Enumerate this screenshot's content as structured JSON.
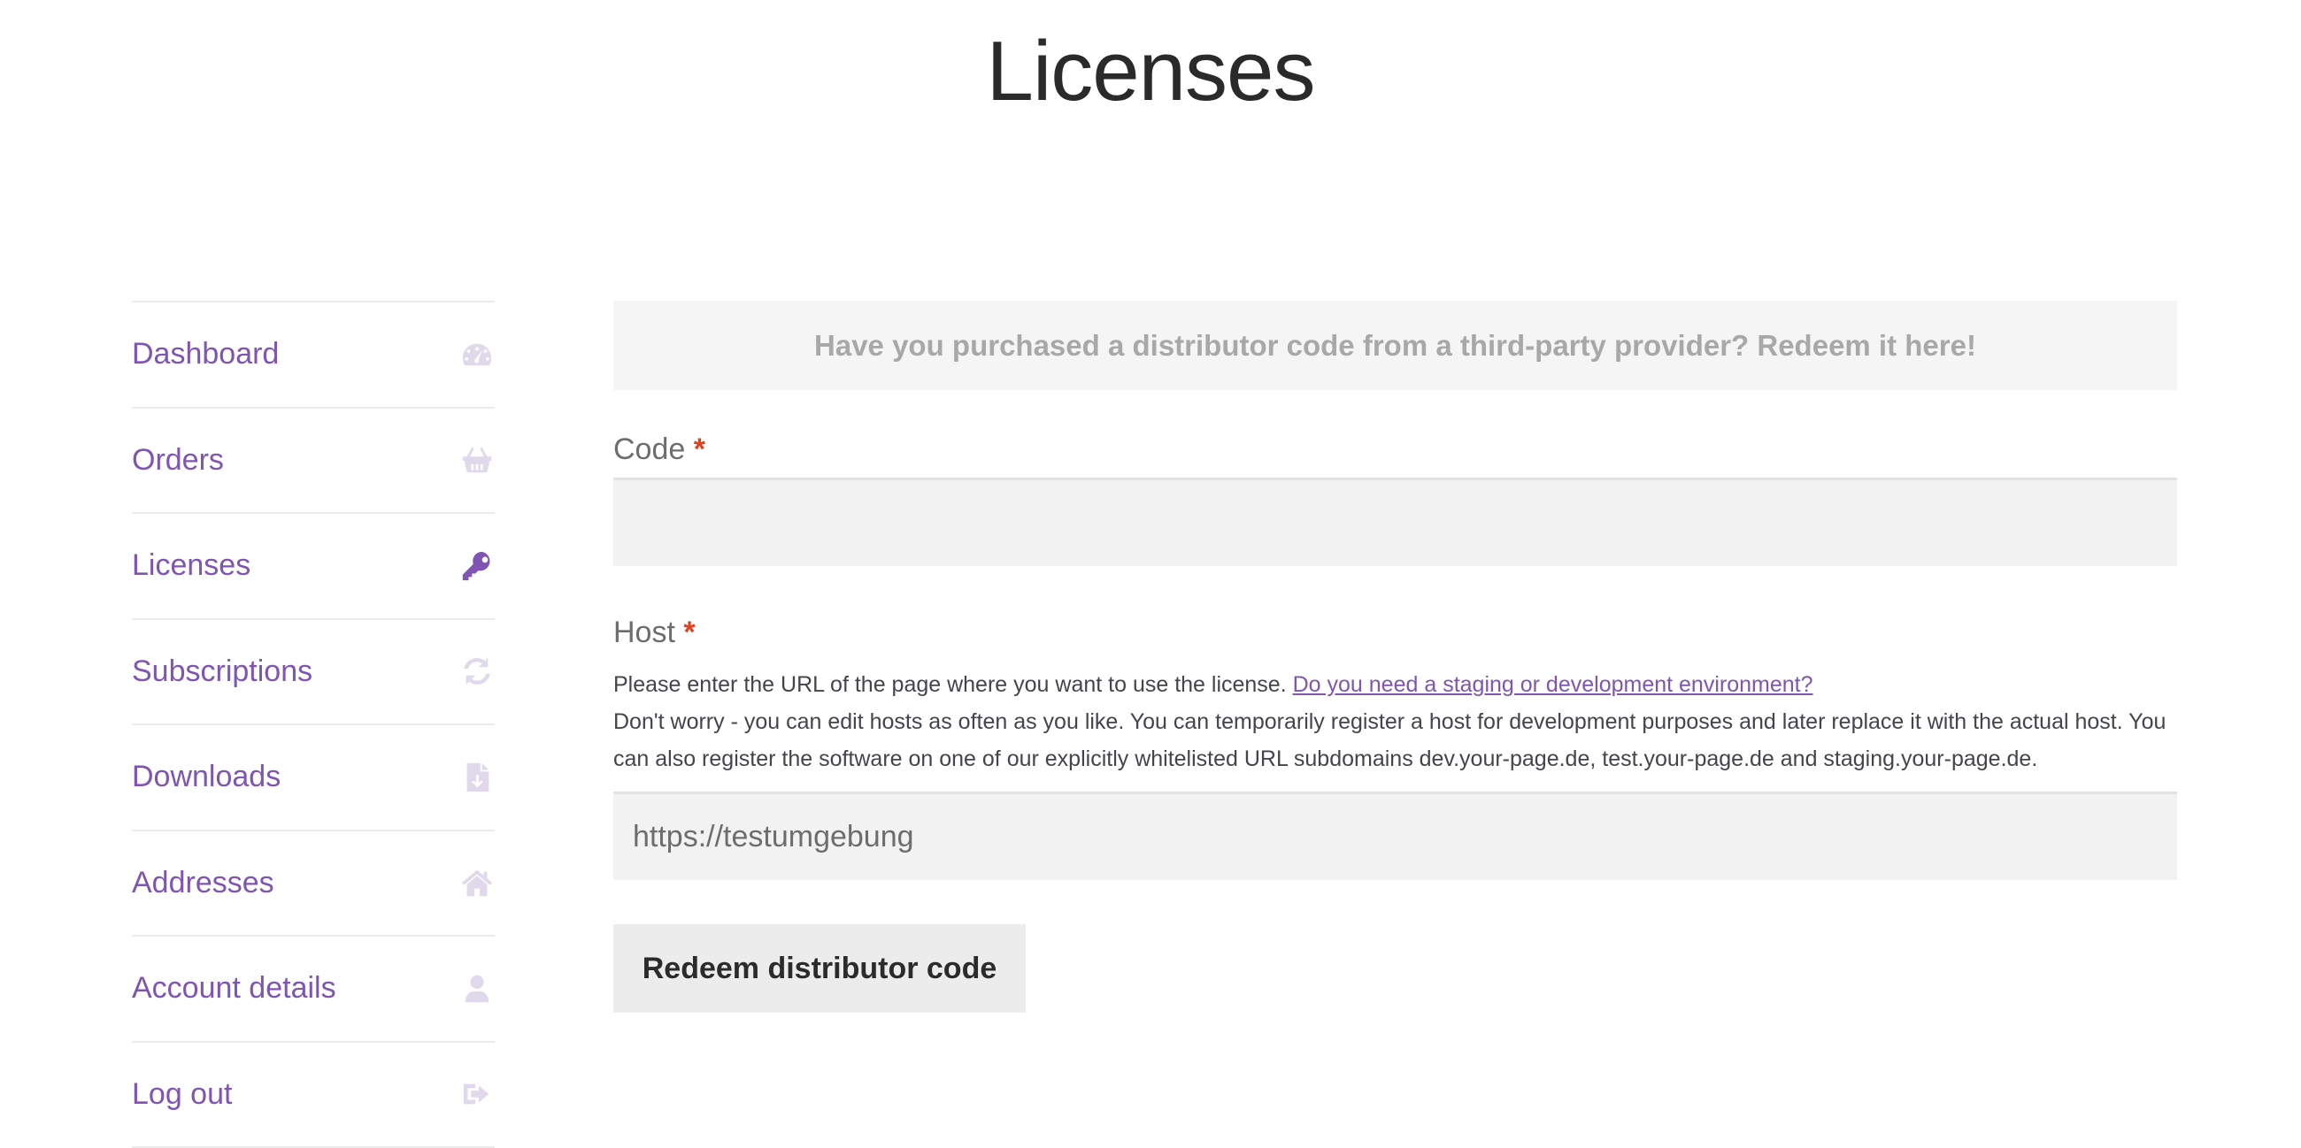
{
  "page": {
    "title": "Licenses"
  },
  "nav": {
    "items": [
      {
        "label": "Dashboard",
        "icon": "dashboard-icon"
      },
      {
        "label": "Orders",
        "icon": "basket-icon"
      },
      {
        "label": "Licenses",
        "icon": "key-icon",
        "active": true
      },
      {
        "label": "Subscriptions",
        "icon": "refresh-icon"
      },
      {
        "label": "Downloads",
        "icon": "file-icon"
      },
      {
        "label": "Addresses",
        "icon": "home-icon"
      },
      {
        "label": "Account details",
        "icon": "user-icon"
      },
      {
        "label": "Log out",
        "icon": "sign-out-icon"
      }
    ]
  },
  "form": {
    "notice": "Have you purchased a distributor code from a third-party provider? Redeem it here!",
    "code_label": "Code",
    "required_mark": "*",
    "code_value": "",
    "host_label": "Host",
    "host_help_text": "Please enter the URL of the page where you want to use the license.",
    "host_help_link": "Do you need a staging or development environment?",
    "host_help_note": "Don't worry - you can edit hosts as often as you like. You can temporarily register a host for development purposes and later replace it with the actual host. You can also register the software on one of our explicitly whitelisted URL subdomains dev.your-page.de, test.your-page.de and staging.your-page.de.",
    "host_placeholder": "https://testumgebung",
    "submit_label": "Redeem distributor code"
  },
  "colors": {
    "accent": "#7f54b3",
    "required": "#e2401c",
    "inactive_icon": "#e0d9ec"
  }
}
